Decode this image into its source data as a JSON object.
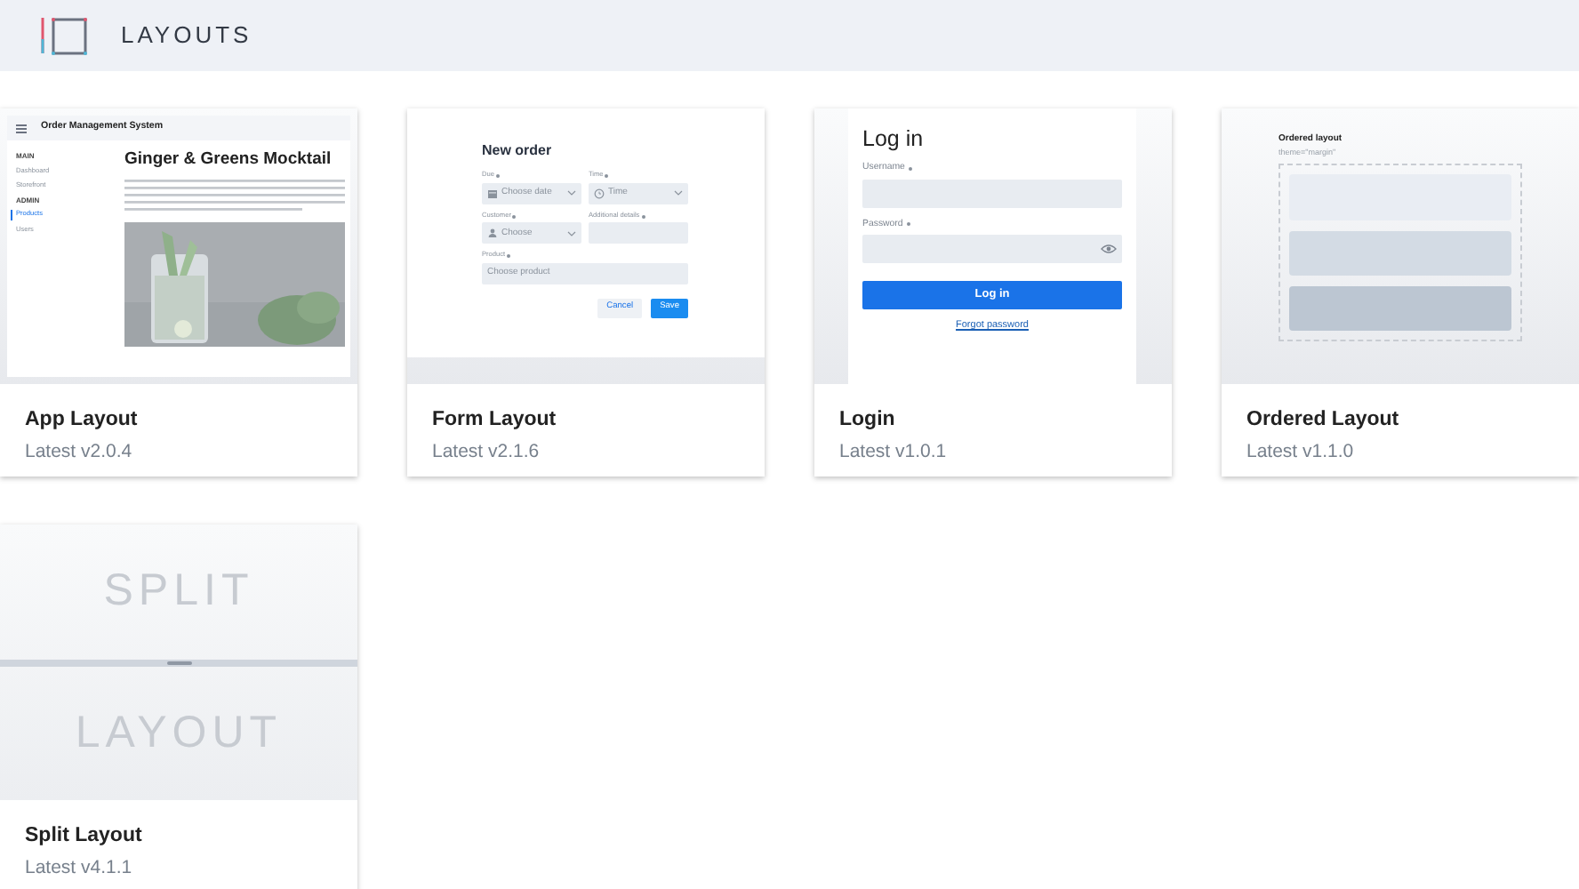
{
  "header": {
    "title": "LAYOUTS"
  },
  "cards": [
    {
      "title": "App Layout",
      "version": "Latest v2.0.4",
      "preview": {
        "kind": "app",
        "app_title": "Order Management System",
        "nav": [
          {
            "kind": "heading",
            "label": "MAIN",
            "selected": false
          },
          {
            "kind": "item",
            "label": "Dashboard",
            "selected": false
          },
          {
            "kind": "item",
            "label": "Storefront",
            "selected": false
          },
          {
            "kind": "heading",
            "label": "ADMIN",
            "selected": false
          },
          {
            "kind": "item",
            "label": "Products",
            "selected": true
          },
          {
            "kind": "item",
            "label": "Users",
            "selected": false
          }
        ],
        "article_title": "Ginger & Greens Mocktail"
      }
    },
    {
      "title": "Form Layout",
      "version": "Latest v2.1.6",
      "preview": {
        "kind": "form",
        "form_title": "New order",
        "fields": [
          {
            "kind": "date",
            "label": "Due",
            "placeholder": "Choose date"
          },
          {
            "kind": "time",
            "label": "Time",
            "placeholder": "Time"
          },
          {
            "kind": "person",
            "label": "Customer",
            "placeholder": "Choose"
          },
          {
            "kind": "text",
            "label": "Additional details"
          },
          {
            "kind": "combo",
            "label": "Product",
            "placeholder": "Choose product"
          }
        ],
        "buttons": [
          {
            "kind": "secondary",
            "label": "Cancel"
          },
          {
            "kind": "primary",
            "label": "Save"
          }
        ]
      }
    },
    {
      "title": "Login",
      "version": "Latest v1.0.1",
      "preview": {
        "kind": "login",
        "login_title": "Log in",
        "fields": [
          {
            "kind": "text",
            "label": "Username"
          },
          {
            "kind": "password",
            "label": "Password"
          }
        ],
        "button": "Log in",
        "link": "Forgot password"
      }
    },
    {
      "title": "Ordered Layout",
      "version": "Latest v1.1.0",
      "preview": {
        "kind": "ordered",
        "heading": "Ordered layout",
        "subtitle": "theme=\"margin\"",
        "blocks": [
          {
            "color": "#e9edf3"
          },
          {
            "color": "#d3dbe4"
          },
          {
            "color": "#bcc6d2"
          }
        ]
      }
    },
    {
      "title": "Split Layout",
      "version": "Latest v4.1.1",
      "preview": {
        "kind": "split",
        "top": "SPLIT",
        "bottom": "LAYOUT"
      }
    }
  ]
}
